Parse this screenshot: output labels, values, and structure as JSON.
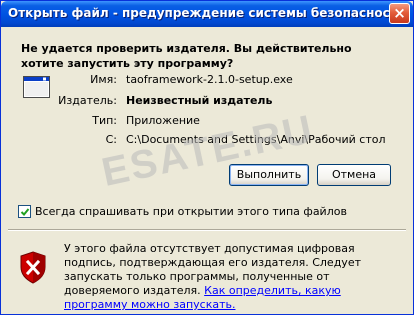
{
  "window": {
    "title": "Открыть файл - предупреждение системы безопасности",
    "close_glyph": "×"
  },
  "question": "Не удается проверить издателя.  Вы действительно хотите запустить эту программу?",
  "details": {
    "name_label": "Имя:",
    "name_value": "taoframework-2.1.0-setup.exe",
    "publisher_label": "Издатель:",
    "publisher_value": "Неизвестный издатель",
    "type_label": "Тип:",
    "type_value": "Приложение",
    "from_label": "С:",
    "from_value": "C:\\Documents and Settings\\Anvi\\Рабочий стол"
  },
  "watermark": "ESATE.RU",
  "buttons": {
    "run_label": "Выполнить",
    "cancel_label": "Отмена"
  },
  "checkbox": {
    "label": "Всегда спрашивать при открытии этого типа файлов",
    "checked": true
  },
  "warning": {
    "text": "У этого файла отсутствует допустимая цифровая подпись, подтверждающая его издателя.  Следует запускать только программы, полученные от доверяемого издателя. ",
    "link_text": "Как определить, какую программу можно запускать."
  },
  "icons": {
    "app": "application-window-icon",
    "shield": "security-shield-icon",
    "check": "checkmark-icon"
  },
  "colors": {
    "titlebar": "#0054e3",
    "window_bg": "#ece9d8",
    "link": "#0000ff",
    "shield_red": "#cc0000"
  }
}
